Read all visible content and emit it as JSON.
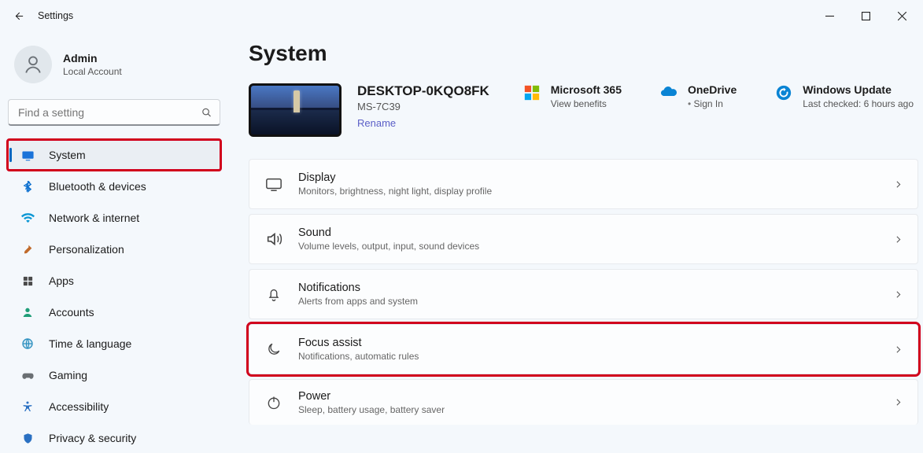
{
  "window": {
    "title": "Settings"
  },
  "account": {
    "name": "Admin",
    "type": "Local Account"
  },
  "search": {
    "placeholder": "Find a setting"
  },
  "sidebar": {
    "items": [
      {
        "label": "System"
      },
      {
        "label": "Bluetooth & devices"
      },
      {
        "label": "Network & internet"
      },
      {
        "label": "Personalization"
      },
      {
        "label": "Apps"
      },
      {
        "label": "Accounts"
      },
      {
        "label": "Time & language"
      },
      {
        "label": "Gaming"
      },
      {
        "label": "Accessibility"
      },
      {
        "label": "Privacy & security"
      }
    ]
  },
  "page": {
    "title": "System"
  },
  "device": {
    "name": "DESKTOP-0KQO8FK",
    "model": "MS-7C39",
    "rename": "Rename"
  },
  "tiles": {
    "m365": {
      "title": "Microsoft 365",
      "sub": "View benefits"
    },
    "onedrive": {
      "title": "OneDrive",
      "sub": "Sign In"
    },
    "update": {
      "title": "Windows Update",
      "sub": "Last checked: 6 hours ago"
    }
  },
  "cards": [
    {
      "title": "Display",
      "sub": "Monitors, brightness, night light, display profile"
    },
    {
      "title": "Sound",
      "sub": "Volume levels, output, input, sound devices"
    },
    {
      "title": "Notifications",
      "sub": "Alerts from apps and system"
    },
    {
      "title": "Focus assist",
      "sub": "Notifications, automatic rules"
    },
    {
      "title": "Power",
      "sub": "Sleep, battery usage, battery saver"
    }
  ]
}
